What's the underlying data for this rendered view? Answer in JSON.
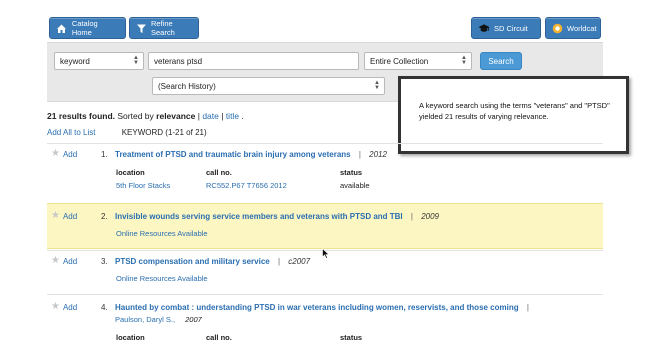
{
  "toolbar": {
    "catalog_home": "Catalog Home",
    "refine_search": "Refine Search",
    "sd_circuit": "SD Circuit",
    "worldcat": "Worldcat"
  },
  "search": {
    "type_value": "keyword",
    "query_value": "veterans ptsd",
    "scope_value": "Entire Collection",
    "history_value": "(Search History)",
    "search_button": "Search"
  },
  "callout": {
    "text": "A keyword search using the terms \"veterans\" and \"PTSD\" yielded 21 results of varying relevance."
  },
  "summary": {
    "count_text": "21 results found.",
    "sorted_by": "Sorted by",
    "relevance": "relevance",
    "date": "date",
    "title": "title",
    "add_all": "Add All to List",
    "range": "KEYWORD (1-21 of 21)"
  },
  "holding_headers": {
    "location": "location",
    "call_no": "call no.",
    "status": "status"
  },
  "results": [
    {
      "add": "Add",
      "num": "1.",
      "title": "Treatment of PTSD and traumatic brain injury among veterans",
      "year": "2012",
      "location": "5th Floor Stacks",
      "call_no": "RC552.P67 T7656 2012",
      "status": "available"
    },
    {
      "add": "Add",
      "num": "2.",
      "title": "Invisible wounds serving service members and veterans with PTSD and TBI",
      "year": "2009",
      "online": "Online Resources Available"
    },
    {
      "add": "Add",
      "num": "3.",
      "title": "PTSD compensation and military service",
      "year": "c2007",
      "online": "Online Resources Available"
    },
    {
      "add": "Add",
      "num": "4.",
      "title": "Haunted by combat : understanding PTSD in war veterans including women, reservists, and those coming",
      "author": "Paulson, Daryl S.,",
      "year": "2007"
    }
  ],
  "colors": {
    "brand_blue": "#3a7bb8",
    "link_blue": "#2a6eb0",
    "highlight": "#fbf6c2"
  }
}
